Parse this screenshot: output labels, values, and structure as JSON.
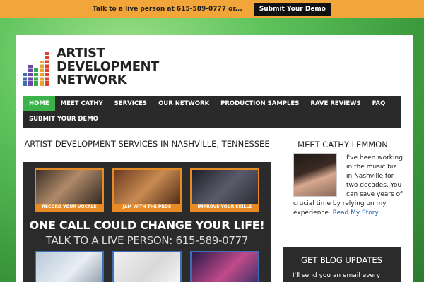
{
  "topbar": {
    "text": "Talk to a live person at 615-589-0777 or...",
    "button": "Submit Your Demo"
  },
  "logo": {
    "line1": "ARTIST",
    "line2": "DEVELOPMENT",
    "line3": "NETWORK"
  },
  "nav": {
    "items": [
      "HOME",
      "MEET CATHY",
      "SERVICES",
      "OUR NETWORK",
      "PRODUCTION SAMPLES",
      "RAVE REVIEWS",
      "FAQ"
    ],
    "row2": [
      "SUBMIT YOUR DEMO"
    ]
  },
  "main": {
    "title": "ARTIST DEVELOPMENT SERVICES IN NASHVILLE, TENNESSEE",
    "promo": {
      "thumbs": [
        "RECORD YOUR VOCALS",
        "JAM WITH THE PROS",
        "IMPROVE YOUR SKILLS"
      ],
      "headline": "ONE CALL COULD CHANGE YOUR LIFE!",
      "subline": "TALK TO A LIVE PERSON: 615-589-0777"
    }
  },
  "sidebar": {
    "title": "MEET CATHY LEMMON",
    "text": "I've been working in the music biz in Nashville for two decades. You can save years of crucial time by relying on my experience.",
    "link": "Read My Story...",
    "blog_title": "GET BLOG UPDATES",
    "blog_text": "I'll send you an email every"
  },
  "colors": {
    "accent_green": "#3cb34a",
    "orange": "#e98b24",
    "nav_bg": "#2a2a2a"
  }
}
